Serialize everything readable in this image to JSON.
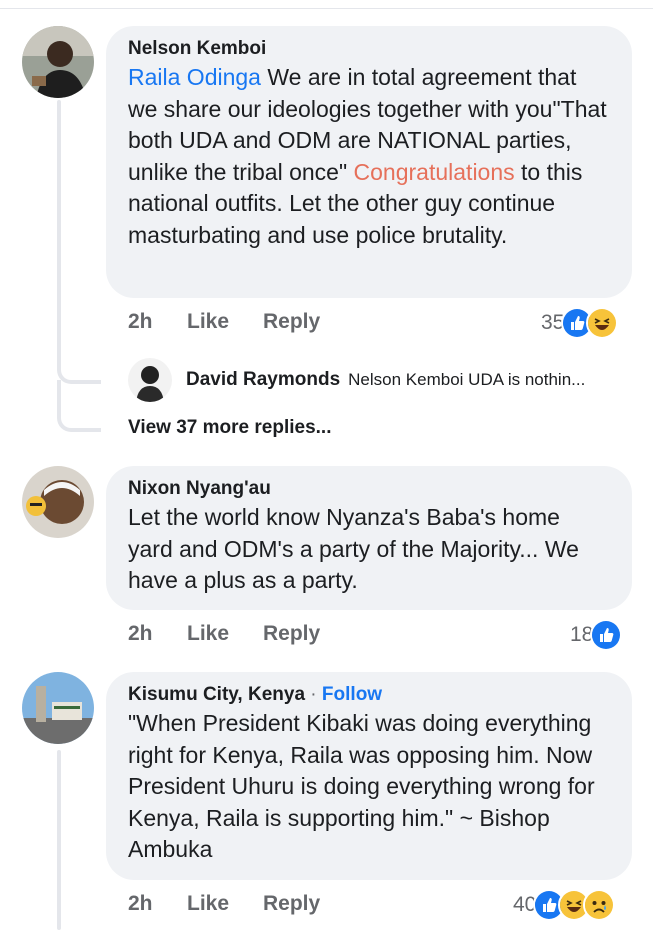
{
  "comments": [
    {
      "author": "Nelson Kemboi",
      "mention": "Raila Odinga",
      "text_a": " We are in total agreement that we share our ideologies together with you\"That both UDA and ODM are NATIONAL parties, unlike the tribal once\" ",
      "hashtag": "Congratulations",
      "text_b": " to this national outfits. Let the other guy continue masturbating  and use police brutality.",
      "time": "2h",
      "like": "Like",
      "reply": "Reply",
      "reaction_count": "35",
      "reactions": [
        "like-icon",
        "haha-icon"
      ]
    },
    {
      "author": "Nixon Nyang'au",
      "text": "Let the world know Nyanza's Baba's home yard and ODM's a party of the Majority... We have a plus as a party.",
      "time": "2h",
      "like": "Like",
      "reply": "Reply",
      "reaction_count": "18",
      "reactions": [
        "like-icon"
      ]
    },
    {
      "author": "Kisumu City, Kenya",
      "separator": " · ",
      "follow": "Follow",
      "text": "\"When President Kibaki was doing everything right for Kenya, Raila was opposing him. Now President Uhuru is doing everything wrong for Kenya, Raila is supporting him.\" ~ Bishop Ambuka",
      "time": "2h",
      "like": "Like",
      "reply": "Reply",
      "reaction_count": "40",
      "reactions": [
        "like-icon",
        "haha-icon",
        "sad-icon"
      ]
    }
  ],
  "reply_preview": {
    "author": "David Raymonds",
    "snippet": "Nelson Kemboi UDA is nothin..."
  },
  "view_more": "View 37 more replies...",
  "colors": {
    "link": "#1877f2",
    "hashtag": "#e6705a",
    "bubble": "#f0f2f5",
    "meta": "#65676b"
  }
}
